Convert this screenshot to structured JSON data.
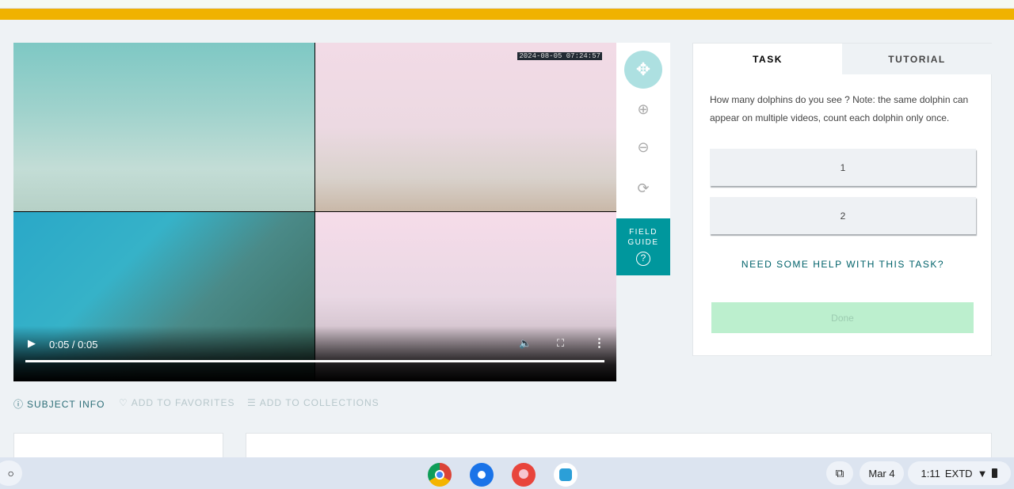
{
  "video": {
    "timestamp": "2024-08-05 07:24:57",
    "time": "0:05 / 0:05"
  },
  "toolbar": {
    "field_guide_line1": "FIELD",
    "field_guide_line2": "GUIDE",
    "help_glyph": "?"
  },
  "task": {
    "tabs": [
      "TASK",
      "TUTORIAL"
    ],
    "question": "How many dolphins do you see ? Note: the same dolphin can appear on multiple videos, count each dolphin only once.",
    "answers": [
      "1",
      "2"
    ],
    "help": "NEED SOME HELP WITH THIS TASK?",
    "done": "Done"
  },
  "meta": {
    "subject_info": "SUBJECT INFO",
    "favorites": "ADD TO FAVORITES",
    "collections": "ADD TO COLLECTIONS"
  },
  "shelf": {
    "date": "Mar 4",
    "time": "1:11",
    "status": "EXTD"
  },
  "colors": {
    "accent": "#00979d",
    "banner": "#f0b200"
  }
}
